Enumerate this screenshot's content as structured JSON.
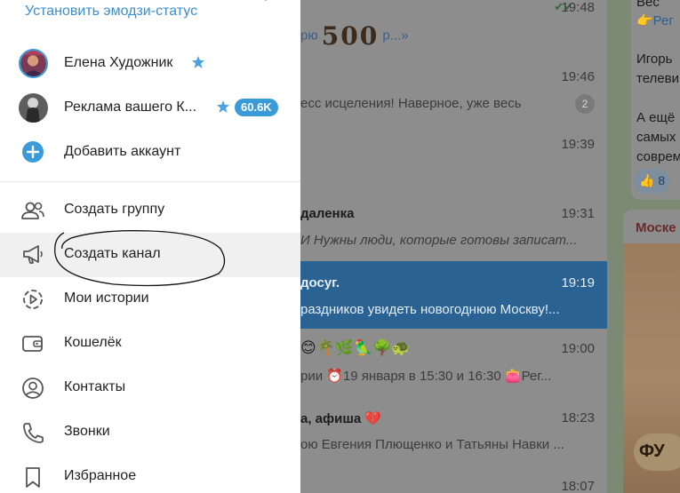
{
  "drawer": {
    "status_link": "Установить эмодзи-статус",
    "accounts": [
      {
        "name": "Елена Художник",
        "premium": true
      },
      {
        "name": "Реклама вашего К...",
        "premium": true,
        "badge": "60.6K"
      }
    ],
    "add_account": "Добавить аккаунт",
    "menu": [
      {
        "label": "Создать группу",
        "icon": "people-icon"
      },
      {
        "label": "Создать канал",
        "icon": "megaphone-icon",
        "highlighted": true
      },
      {
        "label": "Мои истории",
        "icon": "stories-icon"
      },
      {
        "label": "Кошелёк",
        "icon": "wallet-icon"
      },
      {
        "label": "Контакты",
        "icon": "contact-icon"
      },
      {
        "label": "Звонки",
        "icon": "phone-icon"
      },
      {
        "label": "Избранное",
        "icon": "bookmark-icon"
      }
    ],
    "accent_color": "#3b9ad9"
  },
  "chat_list": {
    "promo_prefix": "рю",
    "promo_big": "500",
    "promo_suffix": "р...»",
    "rows": [
      {
        "name": "",
        "time": "19:48",
        "preview": ""
      },
      {
        "name": "",
        "time": "19:46",
        "preview": "есс исцеления!  Наверное, уже весь",
        "badge": "2"
      },
      {
        "name": "",
        "time": "19:39",
        "preview": ""
      },
      {
        "name": "даленка",
        "time": "19:31",
        "preview": "И  Нужны люди, которые готовы записат..."
      },
      {
        "name": "досуг.",
        "time": "19:19",
        "preview": "раздников увидеть новогоднюю Москву!..."
      },
      {
        "name": "😊🌴🌿🦜🌳🐢",
        "time": "19:00",
        "preview": "рии  ⏰19 января в 15:30 и 16:30 👛Рег..."
      },
      {
        "name": "а, афиша 💔",
        "time": "18:23",
        "preview": "ою Евгения Плющенко и Татьяны Навки ..."
      },
      {
        "name": "",
        "time": "18:07",
        "preview": ""
      }
    ]
  },
  "conversation": {
    "lines": [
      "Вес",
      "👉Рег",
      "",
      "Игорь",
      "телеви",
      "",
      "А ещё",
      "самых",
      "соврем"
    ],
    "reaction_emoji": "👍",
    "reaction_count": "8",
    "post_title": "Моске",
    "post_sign": "ФУ"
  }
}
